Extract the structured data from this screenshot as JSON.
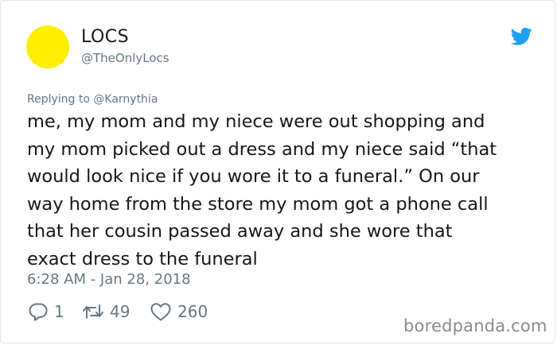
{
  "user": {
    "display_name": "LOCS",
    "handle": "@TheOnlyLocs",
    "avatar_color": "#ffee00"
  },
  "tweet": {
    "reply_prefix": "Replying to ",
    "reply_mention": "@Karnythia",
    "text": "me, my mom and my niece were out shopping and\nmy mom picked out a dress and my niece said “that\nwould look nice if you wore it to a funeral.” On our\nway home from the store my mom got a phone call\nthat her cousin passed away and she wore that\nexact dress to the funeral",
    "timestamp": "6:28 AM - Jan 28, 2018"
  },
  "actions": {
    "reply_count": "1",
    "retweet_count": "49",
    "like_count": "260",
    "reply_icon": "speech-bubble-icon",
    "retweet_icon": "retweet-icon",
    "like_icon": "heart-icon"
  },
  "brand": {
    "icon": "twitter-bird-icon",
    "color": "#1da1f2"
  },
  "watermark": "boredpanda.com"
}
